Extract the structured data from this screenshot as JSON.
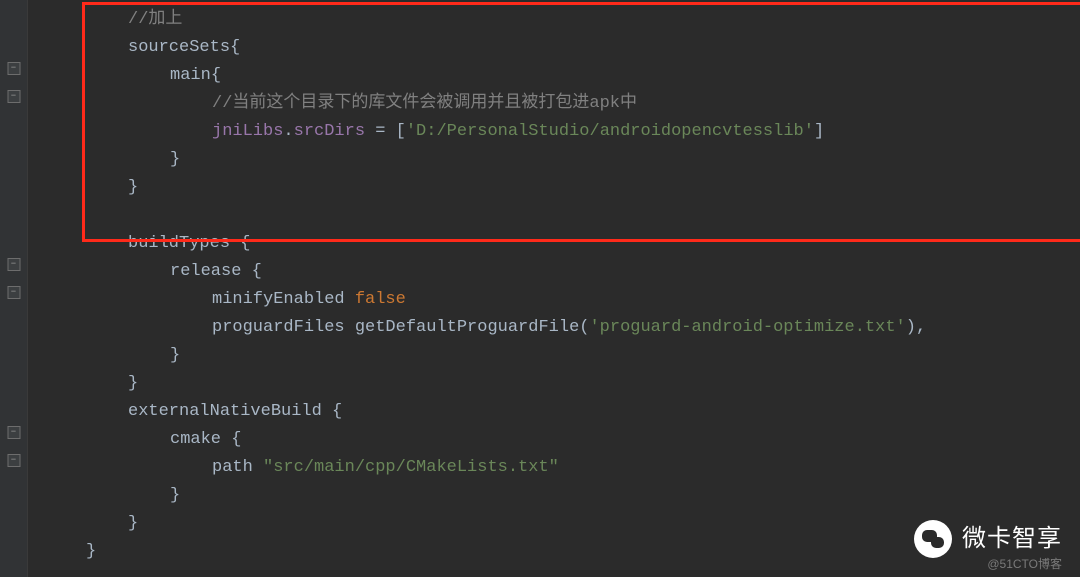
{
  "code": {
    "comment_add": "//加上",
    "sourceSets": "sourceSets",
    "main": "main",
    "comment_dir": "//当前这个目录下的库文件会被调用并且被打包进apk中",
    "jniLibs": "jniLibs",
    "srcDirs": "srcDirs",
    "equals": " = ",
    "path_value": "'D:/PersonalStudio/androidopencvtesslib'",
    "buildTypes": "buildTypes",
    "release": "release",
    "minifyEnabled": "minifyEnabled",
    "false_val": "false",
    "proguardFiles": "proguardFiles",
    "getDefaultProguardFile": "getDefaultProguardFile",
    "proguard_txt": "'proguard-android-optimize.txt'",
    "externalNativeBuild": "externalNativeBuild",
    "cmake": "cmake",
    "path_kw": "path",
    "cmake_path": "\"src/main/cpp/CMakeLists.txt\"",
    "open_brace": "{",
    "close_brace": "}",
    "open_bracket": "[",
    "close_bracket": "]",
    "open_paren": "(",
    "close_paren": ")",
    "dot": ".",
    "comma": ","
  },
  "watermark": {
    "main": "微卡智享",
    "sub": "@51CTO博客"
  }
}
